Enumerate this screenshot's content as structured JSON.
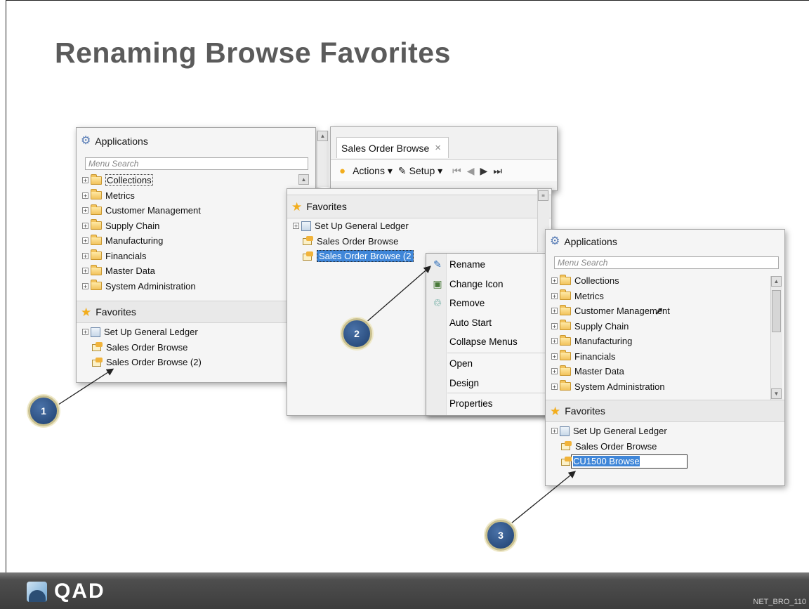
{
  "slide": {
    "title": "Renaming Browse Favorites",
    "slide_code": "NET_BRO_110",
    "logo_text": "QAD"
  },
  "panel1": {
    "applications_label": "Applications",
    "search_placeholder": "Menu Search",
    "menu_items": [
      "Collections",
      "Metrics",
      "Customer Management",
      "Supply Chain",
      "Manufacturing",
      "Financials",
      "Master Data",
      "System Administration"
    ],
    "favorites_label": "Favorites",
    "favorites": [
      "Set Up General Ledger",
      "Sales Order Browse",
      "Sales Order Browse (2)"
    ]
  },
  "browse_tab": {
    "tab_label": "Sales Order Browse",
    "close_glyph": "×",
    "actions_label": "Actions",
    "setup_label": "Setup"
  },
  "panel2": {
    "favorites_label": "Favorites",
    "favorites": [
      "Set Up General Ledger",
      "Sales Order Browse",
      "Sales Order Browse (2"
    ]
  },
  "context_menu": {
    "items": [
      "Rename",
      "Change Icon",
      "Remove",
      "Auto Start",
      "Collapse Menus",
      "Open",
      "Design",
      "Properties"
    ]
  },
  "panel3": {
    "applications_label": "Applications",
    "search_placeholder": "Menu Search",
    "menu_items": [
      "Collections",
      "Metrics",
      "Customer Management",
      "Supply Chain",
      "Manufacturing",
      "Financials",
      "Master Data",
      "System Administration"
    ],
    "favorites_label": "Favorites",
    "favorites": [
      "Set Up General Ledger",
      "Sales Order Browse"
    ],
    "rename_value": "CU1500 Browse"
  },
  "callouts": [
    "1",
    "2",
    "3"
  ],
  "colors": {
    "selection": "#3f86d8",
    "callout": "#2a4f82",
    "footer": "#3d3d3d",
    "title": "#5b5b5b"
  }
}
